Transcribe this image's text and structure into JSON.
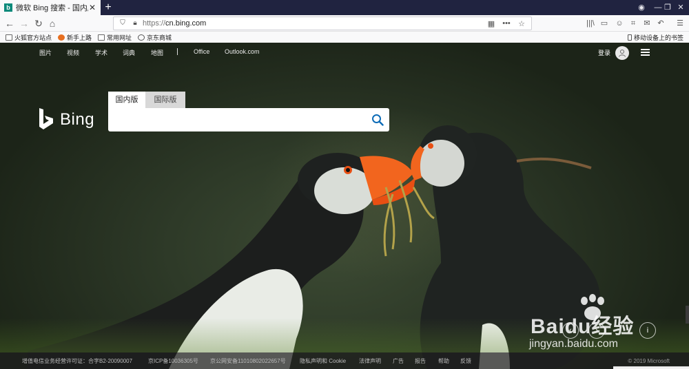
{
  "browser": {
    "tab_title": "微软 Bing 搜索 - 国内版",
    "tab_favicon": "b",
    "new_tab": "+",
    "url_protocol": "https://",
    "url_host": "cn.bing.com",
    "window_controls": {
      "minimize": "—",
      "maximize": "❐",
      "close": "✕"
    }
  },
  "bookmarks": {
    "items": [
      {
        "label": "火狐官方站点",
        "icon": "folder-icon"
      },
      {
        "label": "新手上路",
        "icon": "firefox-icon"
      },
      {
        "label": "常用网址",
        "icon": "folder-icon"
      },
      {
        "label": "京东商城",
        "icon": "globe-icon"
      }
    ],
    "mobile": "移动设备上的书签"
  },
  "bing": {
    "nav": [
      "图片",
      "视频",
      "学术",
      "词典",
      "地图",
      "Office",
      "Outlook.com"
    ],
    "login": "登录",
    "logo_text": "Bing",
    "scope_tabs": [
      "国内版",
      "国际版"
    ],
    "search_placeholder": "",
    "footer": [
      "增值电信业务经营许可证：合字B2-20090007",
      "京ICP备10036305号",
      "京公网安备11010802022657号",
      "隐私声明和 Cookie",
      "法律声明",
      "广告",
      "报告",
      "帮助",
      "反馈"
    ],
    "copyright": "© 2019 Microsoft"
  },
  "watermark": {
    "main": "Baidu经验",
    "sub": "jingyan.baidu.com"
  },
  "colors": {
    "tabstrip": "#202340",
    "bing_teal": "#0d8a7b",
    "search_icon": "#0c6bb7"
  }
}
